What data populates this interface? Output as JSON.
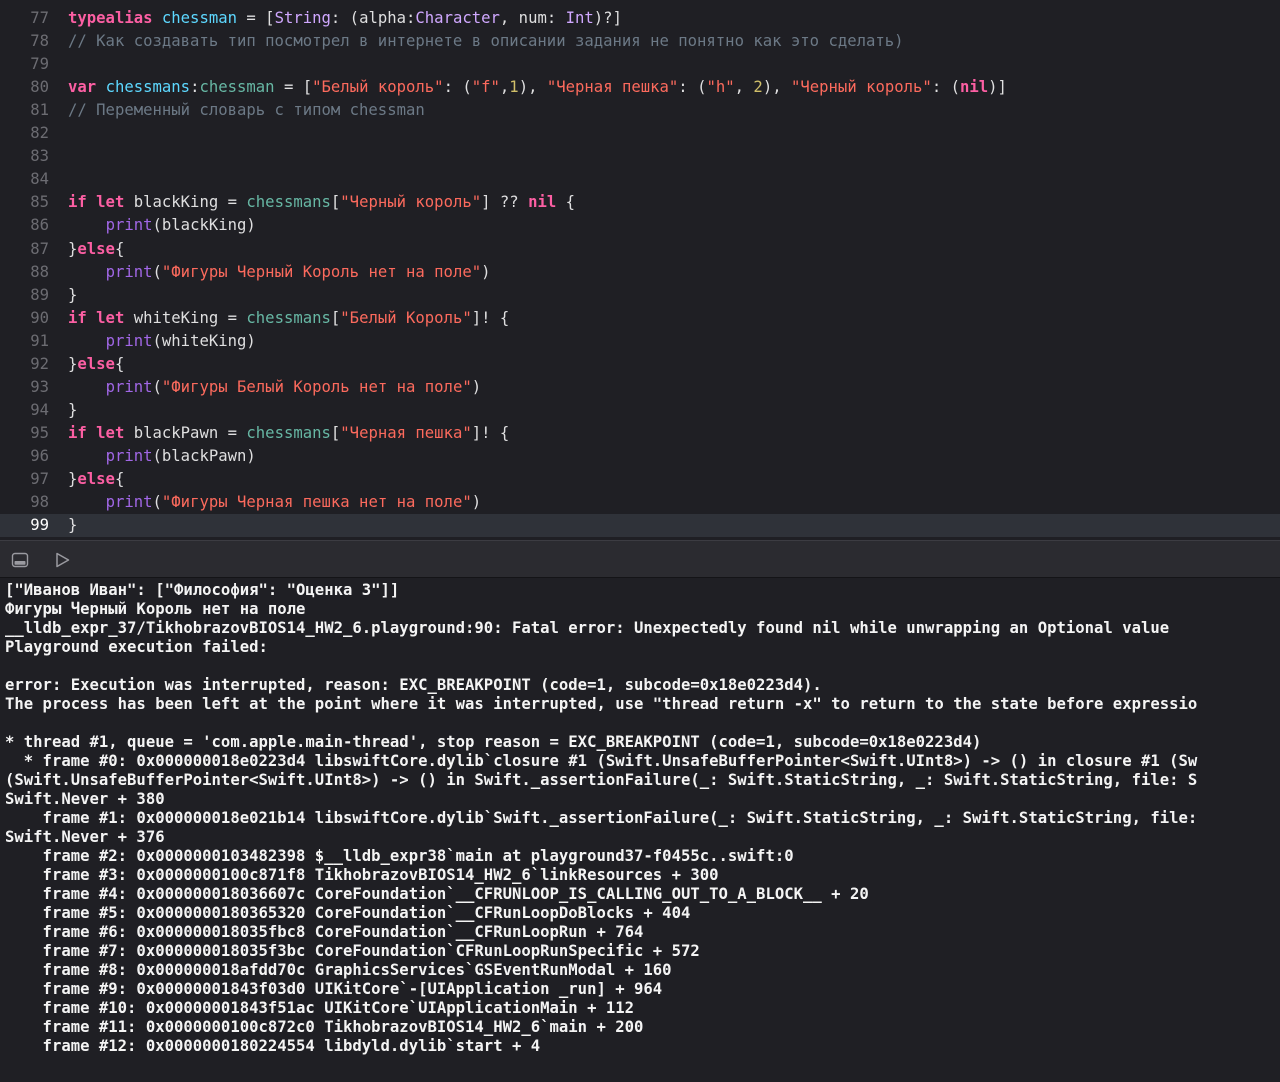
{
  "editor": {
    "lines": [
      {
        "number": "77",
        "tokens": [
          {
            "t": "typealias",
            "c": "kw"
          },
          {
            "t": " ",
            "c": "pl"
          },
          {
            "t": "chessman",
            "c": "tyu"
          },
          {
            "t": " = [",
            "c": "pl"
          },
          {
            "t": "String",
            "c": "ty"
          },
          {
            "t": ": (alpha:",
            "c": "pl"
          },
          {
            "t": "Character",
            "c": "ty"
          },
          {
            "t": ", num: ",
            "c": "pl"
          },
          {
            "t": "Int",
            "c": "ty"
          },
          {
            "t": ")?]",
            "c": "pl"
          }
        ]
      },
      {
        "number": "78",
        "tokens": [
          {
            "t": "// Как создавать тип посмотрел в интернете в описании задания не понятно как это сделать)",
            "c": "cm"
          }
        ]
      },
      {
        "number": "79",
        "tokens": []
      },
      {
        "number": "80",
        "tokens": [
          {
            "t": "var",
            "c": "kw"
          },
          {
            "t": " ",
            "c": "pl"
          },
          {
            "t": "chessmans",
            "c": "tyu"
          },
          {
            "t": ":",
            "c": "pl"
          },
          {
            "t": "chessman",
            "c": "var"
          },
          {
            "t": " = [",
            "c": "pl"
          },
          {
            "t": "\"Белый король\"",
            "c": "str"
          },
          {
            "t": ": (",
            "c": "pl"
          },
          {
            "t": "\"f\"",
            "c": "str"
          },
          {
            "t": ",",
            "c": "pl"
          },
          {
            "t": "1",
            "c": "num"
          },
          {
            "t": "), ",
            "c": "pl"
          },
          {
            "t": "\"Черная пешка\"",
            "c": "str"
          },
          {
            "t": ": (",
            "c": "pl"
          },
          {
            "t": "\"h\"",
            "c": "str"
          },
          {
            "t": ", ",
            "c": "pl"
          },
          {
            "t": "2",
            "c": "num"
          },
          {
            "t": "), ",
            "c": "pl"
          },
          {
            "t": "\"Черный король\"",
            "c": "str"
          },
          {
            "t": ": (",
            "c": "pl"
          },
          {
            "t": "nil",
            "c": "kw"
          },
          {
            "t": ")]",
            "c": "pl"
          }
        ]
      },
      {
        "number": "81",
        "tokens": [
          {
            "t": "// Переменный словарь с типом chessman",
            "c": "cm"
          }
        ]
      },
      {
        "number": "82",
        "tokens": []
      },
      {
        "number": "83",
        "tokens": []
      },
      {
        "number": "84",
        "tokens": []
      },
      {
        "number": "85",
        "tokens": [
          {
            "t": "if",
            "c": "kw"
          },
          {
            "t": " ",
            "c": "pl"
          },
          {
            "t": "let",
            "c": "kw"
          },
          {
            "t": " blackKing = ",
            "c": "pl"
          },
          {
            "t": "chessmans",
            "c": "var"
          },
          {
            "t": "[",
            "c": "pl"
          },
          {
            "t": "\"Черный король\"",
            "c": "str"
          },
          {
            "t": "] ?? ",
            "c": "pl"
          },
          {
            "t": "nil",
            "c": "kw"
          },
          {
            "t": " {",
            "c": "pl"
          }
        ]
      },
      {
        "number": "86",
        "tokens": [
          {
            "t": "    ",
            "c": "pl"
          },
          {
            "t": "print",
            "c": "fn"
          },
          {
            "t": "(blackKing)",
            "c": "pl"
          }
        ]
      },
      {
        "number": "87",
        "tokens": [
          {
            "t": "}",
            "c": "pl"
          },
          {
            "t": "else",
            "c": "kw"
          },
          {
            "t": "{",
            "c": "pl"
          }
        ]
      },
      {
        "number": "88",
        "tokens": [
          {
            "t": "    ",
            "c": "pl"
          },
          {
            "t": "print",
            "c": "fn"
          },
          {
            "t": "(",
            "c": "pl"
          },
          {
            "t": "\"Фигуры Черный Король нет на поле\"",
            "c": "str"
          },
          {
            "t": ")",
            "c": "pl"
          }
        ]
      },
      {
        "number": "89",
        "tokens": [
          {
            "t": "}",
            "c": "pl"
          }
        ]
      },
      {
        "number": "90",
        "tokens": [
          {
            "t": "if",
            "c": "kw"
          },
          {
            "t": " ",
            "c": "pl"
          },
          {
            "t": "let",
            "c": "kw"
          },
          {
            "t": " whiteKing = ",
            "c": "pl"
          },
          {
            "t": "chessmans",
            "c": "var"
          },
          {
            "t": "[",
            "c": "pl"
          },
          {
            "t": "\"Белый Король\"",
            "c": "str"
          },
          {
            "t": "]! {",
            "c": "pl"
          }
        ]
      },
      {
        "number": "91",
        "tokens": [
          {
            "t": "    ",
            "c": "pl"
          },
          {
            "t": "print",
            "c": "fn"
          },
          {
            "t": "(whiteKing)",
            "c": "pl"
          }
        ]
      },
      {
        "number": "92",
        "tokens": [
          {
            "t": "}",
            "c": "pl"
          },
          {
            "t": "else",
            "c": "kw"
          },
          {
            "t": "{",
            "c": "pl"
          }
        ]
      },
      {
        "number": "93",
        "tokens": [
          {
            "t": "    ",
            "c": "pl"
          },
          {
            "t": "print",
            "c": "fn"
          },
          {
            "t": "(",
            "c": "pl"
          },
          {
            "t": "\"Фигуры Белый Король нет на поле\"",
            "c": "str"
          },
          {
            "t": ")",
            "c": "pl"
          }
        ]
      },
      {
        "number": "94",
        "tokens": [
          {
            "t": "}",
            "c": "pl"
          }
        ]
      },
      {
        "number": "95",
        "tokens": [
          {
            "t": "if",
            "c": "kw"
          },
          {
            "t": " ",
            "c": "pl"
          },
          {
            "t": "let",
            "c": "kw"
          },
          {
            "t": " blackPawn = ",
            "c": "pl"
          },
          {
            "t": "chessmans",
            "c": "var"
          },
          {
            "t": "[",
            "c": "pl"
          },
          {
            "t": "\"Черная пешка\"",
            "c": "str"
          },
          {
            "t": "]! {",
            "c": "pl"
          }
        ]
      },
      {
        "number": "96",
        "tokens": [
          {
            "t": "    ",
            "c": "pl"
          },
          {
            "t": "print",
            "c": "fn"
          },
          {
            "t": "(blackPawn)",
            "c": "pl"
          }
        ]
      },
      {
        "number": "97",
        "tokens": [
          {
            "t": "}",
            "c": "pl"
          },
          {
            "t": "else",
            "c": "kw"
          },
          {
            "t": "{",
            "c": "pl"
          }
        ]
      },
      {
        "number": "98",
        "tokens": [
          {
            "t": "    ",
            "c": "pl"
          },
          {
            "t": "print",
            "c": "fn"
          },
          {
            "t": "(",
            "c": "pl"
          },
          {
            "t": "\"Фигуры Черная пешка нет на поле\"",
            "c": "str"
          },
          {
            "t": ")",
            "c": "pl"
          }
        ]
      },
      {
        "number": "99",
        "current": true,
        "tokens": [
          {
            "t": "}",
            "c": "pl"
          }
        ]
      }
    ]
  },
  "debug_toolbar": {
    "hide_console_icon": "console-panel-icon",
    "run_icon": "play-icon"
  },
  "console": {
    "lines": [
      "[\"Иванов Иван\": [\"Философия\": \"Оценка 3\"]]",
      "Фигуры Черный Король нет на поле",
      "__lldb_expr_37/TikhobrazovBIOS14_HW2_6.playground:90: Fatal error: Unexpectedly found nil while unwrapping an Optional value",
      "Playground execution failed:",
      "",
      "error: Execution was interrupted, reason: EXC_BREAKPOINT (code=1, subcode=0x18e0223d4).",
      "The process has been left at the point where it was interrupted, use \"thread return -x\" to return to the state before expressio",
      "",
      "* thread #1, queue = 'com.apple.main-thread', stop reason = EXC_BREAKPOINT (code=1, subcode=0x18e0223d4)",
      "  * frame #0: 0x000000018e0223d4 libswiftCore.dylib`closure #1 (Swift.UnsafeBufferPointer<Swift.UInt8>) -> () in closure #1 (Sw",
      "(Swift.UnsafeBufferPointer<Swift.UInt8>) -> () in Swift._assertionFailure(_: Swift.StaticString, _: Swift.StaticString, file: S",
      "Swift.Never + 380",
      "    frame #1: 0x000000018e021b14 libswiftCore.dylib`Swift._assertionFailure(_: Swift.StaticString, _: Swift.StaticString, file:",
      "Swift.Never + 376",
      "    frame #2: 0x0000000103482398 $__lldb_expr38`main at playground37-f0455c..swift:0",
      "    frame #3: 0x0000000100c871f8 TikhobrazovBIOS14_HW2_6`linkResources + 300",
      "    frame #4: 0x000000018036607c CoreFoundation`__CFRUNLOOP_IS_CALLING_OUT_TO_A_BLOCK__ + 20",
      "    frame #5: 0x0000000180365320 CoreFoundation`__CFRunLoopDoBlocks + 404",
      "    frame #6: 0x000000018035fbc8 CoreFoundation`__CFRunLoopRun + 764",
      "    frame #7: 0x000000018035f3bc CoreFoundation`CFRunLoopRunSpecific + 572",
      "    frame #8: 0x000000018afdd70c GraphicsServices`GSEventRunModal + 160",
      "    frame #9: 0x00000001843f03d0 UIKitCore`-[UIApplication _run] + 964",
      "    frame #10: 0x00000001843f51ac UIKitCore`UIApplicationMain + 112",
      "    frame #11: 0x0000000100c872c0 TikhobrazovBIOS14_HW2_6`main + 200",
      "    frame #12: 0x0000000180224554 libdyld.dylib`start + 4"
    ]
  }
}
